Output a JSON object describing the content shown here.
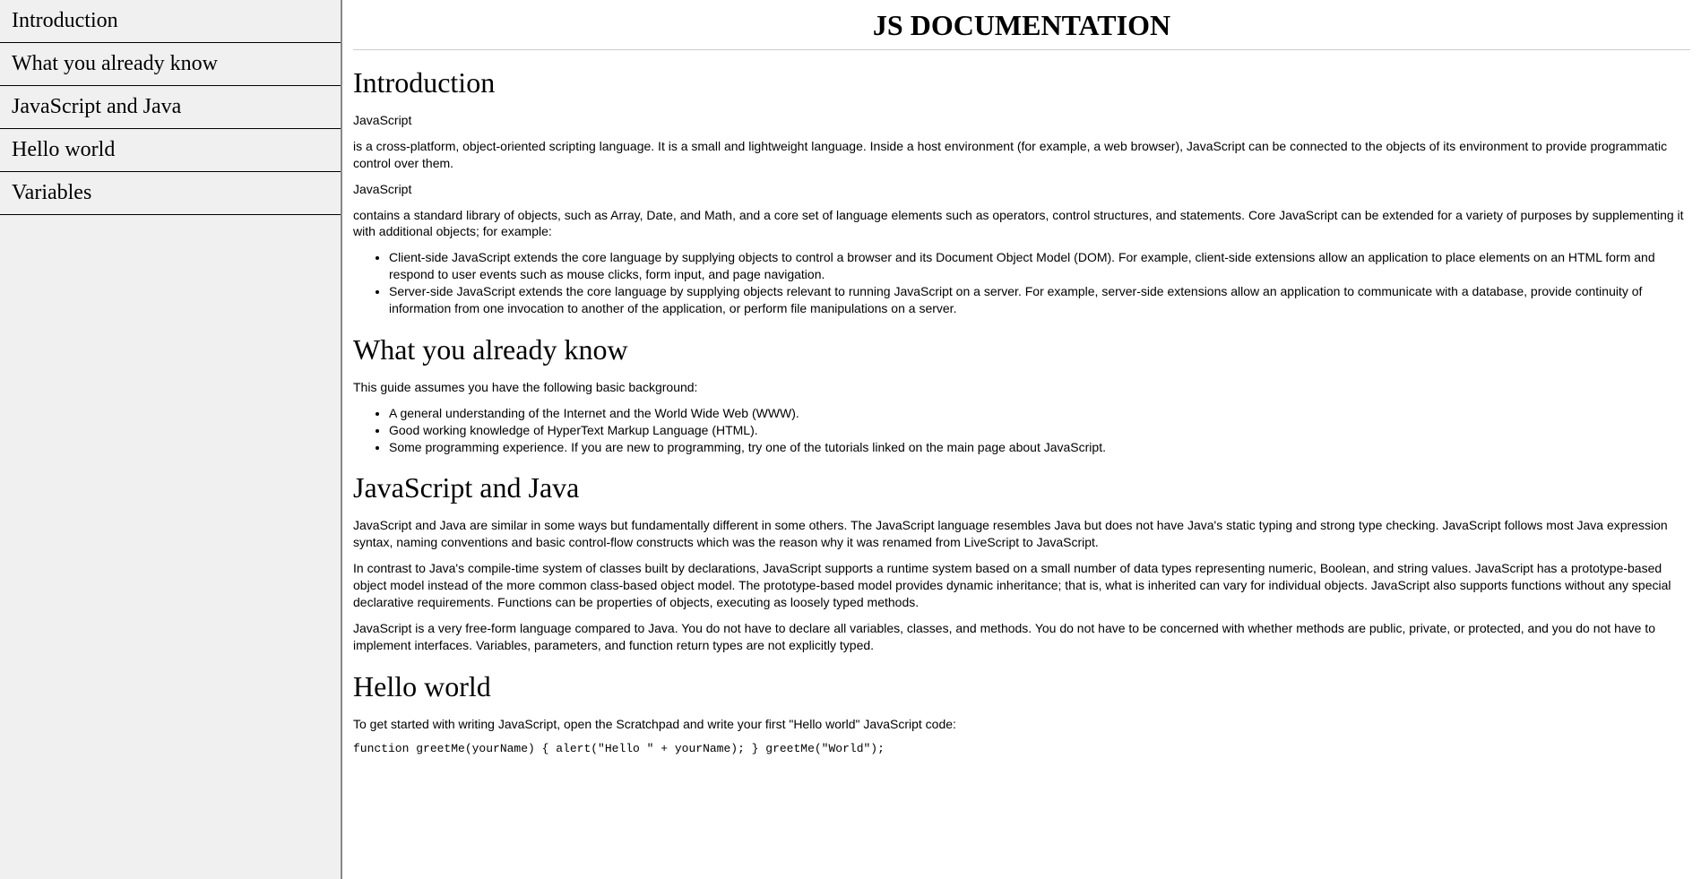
{
  "nav": {
    "items": [
      "Introduction",
      "What you already know",
      "JavaScript and Java",
      "Hello world",
      "Variables"
    ]
  },
  "header": {
    "title": "JS DOCUMENTATION"
  },
  "sections": {
    "intro": {
      "heading": "Introduction",
      "p1": "JavaScript",
      "p2": "is a cross-platform, object-oriented scripting language. It is a small and lightweight language. Inside a host environment (for example, a web browser), JavaScript can be connected to the objects of its environment to provide programmatic control over them.",
      "p3": "JavaScript",
      "p4": "contains a standard library of objects, such as Array, Date, and Math, and a core set of language elements such as operators, control structures, and statements. Core JavaScript can be extended for a variety of purposes by supplementing it with additional objects; for example:",
      "list": [
        "Client-side JavaScript extends the core language by supplying objects to control a browser and its Document Object Model (DOM). For example, client-side extensions allow an application to place elements on an HTML form and respond to user events such as mouse clicks, form input, and page navigation.",
        "Server-side JavaScript extends the core language by supplying objects relevant to running JavaScript on a server. For example, server-side extensions allow an application to communicate with a database, provide continuity of information from one invocation to another of the application, or perform file manipulations on a server."
      ]
    },
    "know": {
      "heading": "What you already know",
      "p1": "This guide assumes you have the following basic background:",
      "list": [
        "A general understanding of the Internet and the World Wide Web (WWW).",
        "Good working knowledge of HyperText Markup Language (HTML).",
        "Some programming experience. If you are new to programming, try one of the tutorials linked on the main page about JavaScript."
      ]
    },
    "jsjava": {
      "heading": "JavaScript and Java",
      "p1": "JavaScript and Java are similar in some ways but fundamentally different in some others. The JavaScript language resembles Java but does not have Java's static typing and strong type checking. JavaScript follows most Java expression syntax, naming conventions and basic control-flow constructs which was the reason why it was renamed from LiveScript to JavaScript.",
      "p2": "In contrast to Java's compile-time system of classes built by declarations, JavaScript supports a runtime system based on a small number of data types representing numeric, Boolean, and string values. JavaScript has a prototype-based object model instead of the more common class-based object model. The prototype-based model provides dynamic inheritance; that is, what is inherited can vary for individual objects. JavaScript also supports functions without any special declarative requirements. Functions can be properties of objects, executing as loosely typed methods.",
      "p3": "JavaScript is a very free-form language compared to Java. You do not have to declare all variables, classes, and methods. You do not have to be concerned with whether methods are public, private, or protected, and you do not have to implement interfaces. Variables, parameters, and function return types are not explicitly typed."
    },
    "hello": {
      "heading": "Hello world",
      "p1": "To get started with writing JavaScript, open the Scratchpad and write your first \"Hello world\" JavaScript code:",
      "code": "function greetMe(yourName) { alert(\"Hello \" + yourName); } greetMe(\"World\");"
    }
  }
}
